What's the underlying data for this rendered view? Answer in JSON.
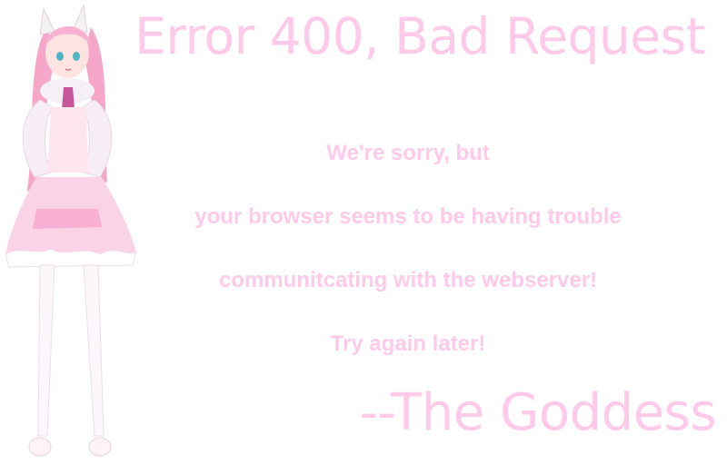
{
  "page": {
    "title": "Error 400, Bad Request",
    "message_lines": [
      "We're sorry, but",
      "your browser seems to be having trouble",
      "communitcating with the webserver!",
      "Try again later!"
    ],
    "signature": "--The Goddess"
  },
  "colors": {
    "text": "#ffcaea",
    "background": "#ffffff"
  },
  "figure_icon": "anime-girl-illustration-icon"
}
